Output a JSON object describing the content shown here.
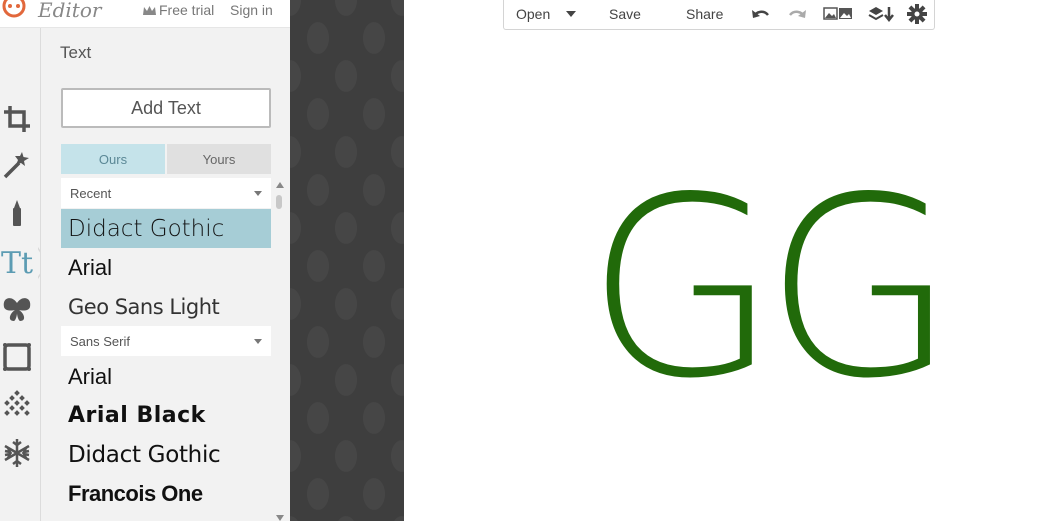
{
  "header": {
    "app_name": "Editor",
    "free_trial_label": "Free trial",
    "sign_in_label": "Sign in"
  },
  "rail": {
    "items": [
      "crop-icon",
      "magic-wand-icon",
      "touch-up-icon",
      "text-icon",
      "overlay-butterfly-icon",
      "frame-icon",
      "texture-icon",
      "theme-snowflake-icon"
    ],
    "active_label": "Tt"
  },
  "panel": {
    "title": "Text",
    "add_text_label": "Add Text",
    "tabs": [
      {
        "label": "Ours",
        "active": true
      },
      {
        "label": "Yours",
        "active": false
      }
    ],
    "sections": [
      {
        "label": "Recent",
        "fonts": [
          "Didact Gothic",
          "Arial",
          "Geo Sans Light"
        ]
      },
      {
        "label": "Sans Serif",
        "fonts": [
          "Arial",
          "Arial Black",
          "Didact Gothic",
          "Francois One"
        ]
      }
    ],
    "selected_font": "Didact Gothic"
  },
  "toolbar": {
    "open_label": "Open",
    "save_label": "Save",
    "share_label": "Share",
    "icons": [
      "undo-icon",
      "redo-icon",
      "collage-icon",
      "layers-icon",
      "gear-icon"
    ]
  },
  "canvas": {
    "text": "GG",
    "text_color": "#216a0a"
  },
  "colors": {
    "accent": "#5c9cb3",
    "selected_row": "#a6cdd6",
    "active_tab": "#c5e3ea"
  }
}
